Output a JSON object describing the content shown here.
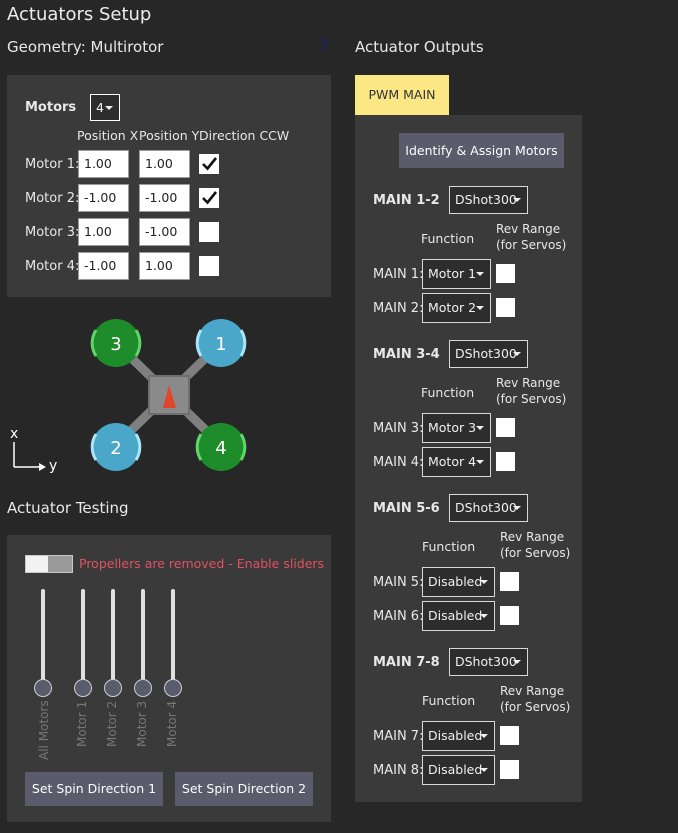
{
  "page": {
    "title": "Actuators Setup",
    "geometry_title": "Geometry: Multirotor",
    "geometry_help": "?",
    "outputs_title": "Actuator Outputs",
    "testing_title": "Actuator Testing"
  },
  "geometry": {
    "motors_label": "Motors",
    "motors_count": "4",
    "col_headers": [
      "Position X",
      "Position Y",
      "Direction CCW"
    ],
    "motors": [
      {
        "label": "Motor 1:",
        "x": "1.00",
        "y": "1.00",
        "ccw": true
      },
      {
        "label": "Motor 2:",
        "x": "-1.00",
        "y": "-1.00",
        "ccw": true
      },
      {
        "label": "Motor 3:",
        "x": "1.00",
        "y": "-1.00",
        "ccw": false
      },
      {
        "label": "Motor 4:",
        "x": "-1.00",
        "y": "1.00",
        "ccw": false
      }
    ]
  },
  "diagram": {
    "rotors": [
      "3",
      "1",
      "2",
      "4"
    ],
    "axis_x": "x",
    "axis_y": "y",
    "colors": {
      "ccw": "#1e8c2a",
      "cw": "#4aa7c9",
      "frame": "#7f7f7f",
      "arrow": "#e0472a"
    }
  },
  "testing": {
    "toggle_label": "Propellers are removed - Enable sliders",
    "sliders": [
      "All Motors",
      "Motor 1",
      "Motor 2",
      "Motor 3",
      "Motor 4"
    ],
    "spin1": "Set Spin Direction 1",
    "spin2": "Set Spin Direction 2"
  },
  "outputs": {
    "tab": "PWM MAIN",
    "identify": "Identify & Assign Motors",
    "function_header": "Function",
    "rev_header_1": "Rev Range",
    "rev_header_2": "(for Servos)",
    "groups": [
      {
        "name": "MAIN 1-2",
        "protocol": "DShot300",
        "rows": [
          {
            "label": "MAIN 1:",
            "func": "Motor 1"
          },
          {
            "label": "MAIN 2:",
            "func": "Motor 2"
          }
        ]
      },
      {
        "name": "MAIN 3-4",
        "protocol": "DShot300",
        "rows": [
          {
            "label": "MAIN 3:",
            "func": "Motor 3"
          },
          {
            "label": "MAIN 4:",
            "func": "Motor 4"
          }
        ]
      },
      {
        "name": "MAIN 5-6",
        "protocol": "DShot300",
        "rows": [
          {
            "label": "MAIN 5:",
            "func": "Disabled"
          },
          {
            "label": "MAIN 6:",
            "func": "Disabled"
          }
        ]
      },
      {
        "name": "MAIN 7-8",
        "protocol": "DShot300",
        "rows": [
          {
            "label": "MAIN 7:",
            "func": "Disabled"
          },
          {
            "label": "MAIN 8:",
            "func": "Disabled"
          }
        ]
      }
    ]
  }
}
